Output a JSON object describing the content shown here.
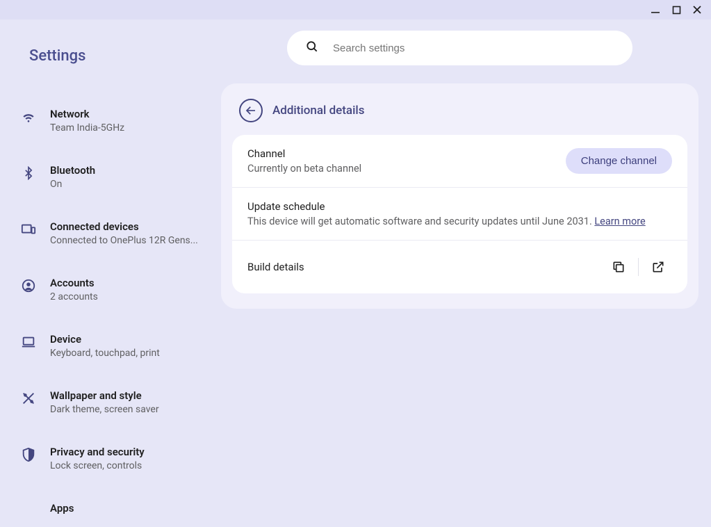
{
  "app": {
    "title": "Settings"
  },
  "search": {
    "placeholder": "Search settings"
  },
  "sidebar": {
    "items": [
      {
        "label": "Network",
        "sub": "Team India-5GHz"
      },
      {
        "label": "Bluetooth",
        "sub": "On"
      },
      {
        "label": "Connected devices",
        "sub": "Connected to OnePlus 12R Gens..."
      },
      {
        "label": "Accounts",
        "sub": "2 accounts"
      },
      {
        "label": "Device",
        "sub": "Keyboard, touchpad, print"
      },
      {
        "label": "Wallpaper and style",
        "sub": "Dark theme, screen saver"
      },
      {
        "label": "Privacy and security",
        "sub": "Lock screen, controls"
      },
      {
        "label": "Apps",
        "sub": ""
      }
    ]
  },
  "panel": {
    "title": "Additional details",
    "channel": {
      "title": "Channel",
      "sub": "Currently on beta channel",
      "button": "Change channel"
    },
    "schedule": {
      "title": "Update schedule",
      "sub_prefix": "This device will get automatic software and security updates until June 2031. ",
      "link": "Learn more"
    },
    "build": {
      "title": "Build details"
    }
  }
}
